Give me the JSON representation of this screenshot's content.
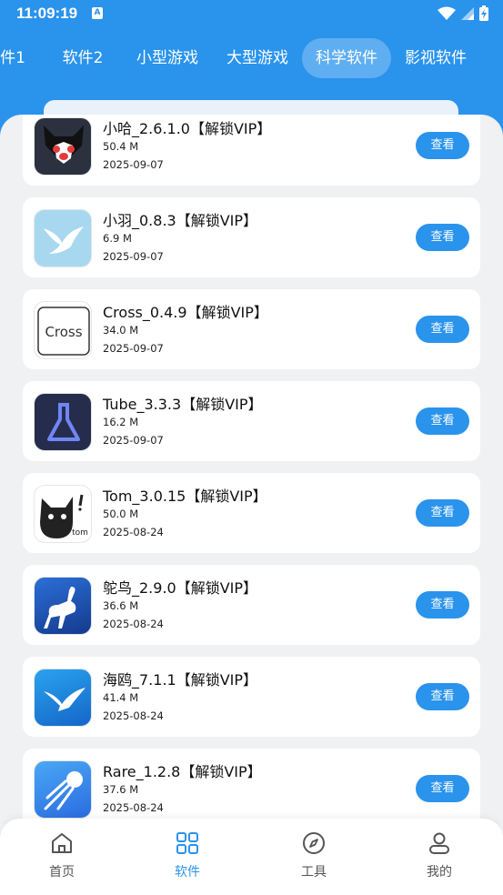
{
  "status": {
    "time": "11:09:19",
    "notif_letter": "A"
  },
  "tabs": [
    {
      "label": "件1"
    },
    {
      "label": "软件2"
    },
    {
      "label": "小型游戏"
    },
    {
      "label": "大型游戏"
    },
    {
      "label": "科学软件",
      "active": true
    },
    {
      "label": "影视软件"
    }
  ],
  "apps": [
    {
      "name": "小哈_2.6.1.0【解锁VIP】",
      "size": "50.4 M",
      "date": "2025-09-07",
      "icon": "husky-icon",
      "button": "查看"
    },
    {
      "name": "小羽_0.8.3【解锁VIP】",
      "size": "6.9 M",
      "date": "2025-09-07",
      "icon": "bird-icon",
      "button": "查看"
    },
    {
      "name": "Cross_0.4.9【解锁VIP】",
      "size": "34.0 M",
      "date": "2025-09-07",
      "icon": "cross-icon",
      "icon_text": "Cross",
      "button": "查看"
    },
    {
      "name": "Tube_3.3.3【解锁VIP】",
      "size": "16.2 M",
      "date": "2025-09-07",
      "icon": "flask-icon",
      "button": "查看"
    },
    {
      "name": "Tom_3.0.15【解锁VIP】",
      "size": "50.0 M",
      "date": "2025-08-24",
      "icon": "cat-icon",
      "icon_text": "tom",
      "button": "查看"
    },
    {
      "name": "鸵鸟_2.9.0【解锁VIP】",
      "size": "36.6 M",
      "date": "2025-08-24",
      "icon": "ostrich-icon",
      "button": "查看"
    },
    {
      "name": "海鸥_7.1.1【解锁VIP】",
      "size": "41.4 M",
      "date": "2025-08-24",
      "icon": "seagull-icon",
      "button": "查看"
    },
    {
      "name": "Rare_1.2.8【解锁VIP】",
      "size": "37.6 M",
      "date": "2025-08-24",
      "icon": "comet-icon",
      "button": "查看"
    }
  ],
  "nav": [
    {
      "label": "首页",
      "icon": "home-icon"
    },
    {
      "label": "软件",
      "icon": "grid-icon",
      "active": true
    },
    {
      "label": "工具",
      "icon": "compass-icon"
    },
    {
      "label": "我的",
      "icon": "user-icon"
    }
  ],
  "colors": {
    "primary": "#2a93ec",
    "background": "#f0f1f3"
  }
}
